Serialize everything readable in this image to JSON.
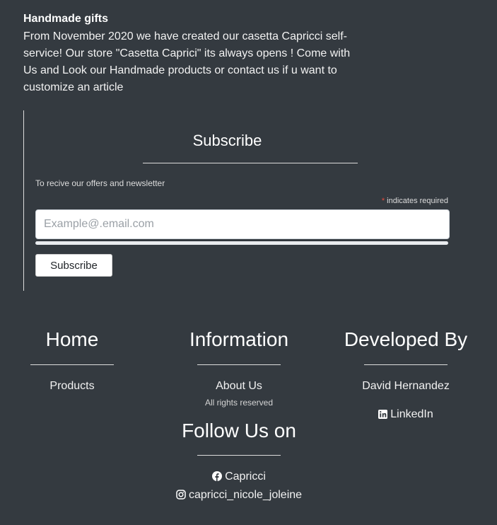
{
  "about": {
    "title": "Handmade gifts",
    "text": "From November 2020 we have created our casetta Capricci self-service! Our store \"Casetta Caprici\" its always opens ! Come with Us and Look our Handmade products or contact us if u want to customize an article"
  },
  "subscribe": {
    "title": "Subscribe",
    "description": "To recive our offers and newsletter",
    "required_star": "*",
    "required_text": "indicates required",
    "email_placeholder": "Example@.email.com",
    "button_label": "Subscribe"
  },
  "footer": {
    "home": {
      "heading": "Home",
      "link": "Products"
    },
    "information": {
      "heading": "Information",
      "link": "About Us",
      "rights": "All rights reserved"
    },
    "developed": {
      "heading": "Developed By",
      "name": "David Hernandez",
      "linkedin": "LinkedIn"
    },
    "follow": {
      "heading": "Follow Us on",
      "facebook": "Capricci",
      "instagram": "capricci_nicole_joleine"
    }
  },
  "icons": {
    "linkedin": "linkedin-icon",
    "facebook": "facebook-icon",
    "instagram": "instagram-icon"
  },
  "colors": {
    "background": "#343a40",
    "text": "#ffffff",
    "required_star": "#e74c3c"
  }
}
